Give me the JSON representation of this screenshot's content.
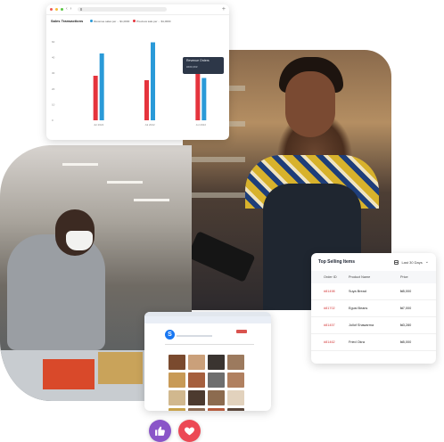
{
  "chart_window": {
    "url_text": "",
    "title": "Sales Transactions",
    "legend": [
      {
        "label": "Revenue sales per ... $1,0000",
        "color": "#2a9ad8"
      },
      {
        "label": "Previous sale per ... $1,0000",
        "color": "#e5343d"
      }
    ],
    "tooltip": {
      "title": "Revenue Orders",
      "value": "####,###"
    }
  },
  "chart_data": {
    "type": "bar",
    "categories": [
      "Jul 2022",
      "Jul 2022",
      "Jul 2022"
    ],
    "series": [
      {
        "name": "Previous sale",
        "values": [
          40,
          36,
          52
        ],
        "color": "#e5343d"
      },
      {
        "name": "Revenue sales",
        "values": [
          60,
          70,
          38
        ],
        "color": "#2a9ad8"
      }
    ],
    "y_ticks": [
      "0",
      "10",
      "20",
      "30",
      "40",
      "60"
    ],
    "ylim": [
      0,
      80
    ],
    "grid": false
  },
  "top_selling": {
    "title": "Top Selling Items",
    "range_label": "Last 30 Days",
    "columns": [
      "Order ID",
      "Product Name",
      "Price"
    ],
    "rows": [
      {
        "id": "#81498",
        "product": "Suya Bread",
        "price": "₦5,000"
      },
      {
        "id": "#81702",
        "product": "Egusi Beans",
        "price": "₦7,000"
      },
      {
        "id": "#81457",
        "product": "Jollof Shawarma",
        "price": "₦3,280"
      },
      {
        "id": "#81462",
        "product": "Fried Okra",
        "price": "₦5,000"
      }
    ]
  },
  "store_page": {
    "logo_glyph": "S",
    "grid_colors": [
      "#7a4a2e",
      "#caa07a",
      "#3a3430",
      "#9c7a5e",
      "#c89a56",
      "#a55f3e",
      "#6e6e6e",
      "#b08060",
      "#d1b88e",
      "#4c3a2f",
      "#8c6b4f",
      "#e2d2bd",
      "#c8a24a",
      "#8b6a52",
      "#b45a3c",
      "#5a463a"
    ]
  },
  "reactions": {
    "like_icon": "thumbs-up-icon",
    "heart_icon": "heart-icon"
  }
}
